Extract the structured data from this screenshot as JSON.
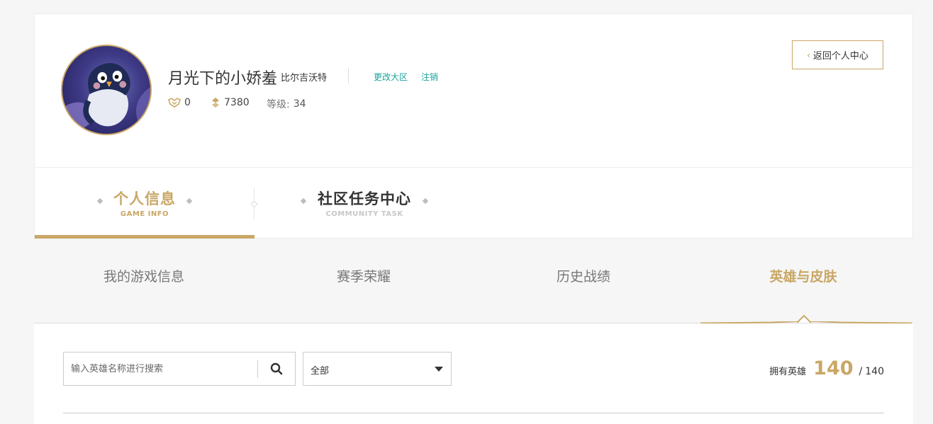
{
  "profile": {
    "username": "月光下的小娇羞",
    "server": "比尔吉沃特",
    "change_server": "更改大区",
    "logout": "注销",
    "honor": "0",
    "coins": "7380",
    "level_label": "等级:",
    "level": "34",
    "back_button": "返回个人中心"
  },
  "main_tabs": [
    {
      "title": "个人信息",
      "sub": "GAME INFO",
      "active": true
    },
    {
      "title": "社区任务中心",
      "sub": "COMMUNITY TASK",
      "active": false
    }
  ],
  "sub_tabs": [
    {
      "label": "我的游戏信息",
      "active": false
    },
    {
      "label": "赛季荣耀",
      "active": false
    },
    {
      "label": "历史战绩",
      "active": false
    },
    {
      "label": "英雄与皮肤",
      "active": true
    }
  ],
  "search": {
    "placeholder": "输入英雄名称进行搜索",
    "value": ""
  },
  "filter": {
    "selected": "全部"
  },
  "owned": {
    "label": "拥有英雄",
    "count": "140",
    "separator": "/",
    "total": "140"
  },
  "colors": {
    "accent": "#c9a766",
    "link": "#1aa39a"
  }
}
